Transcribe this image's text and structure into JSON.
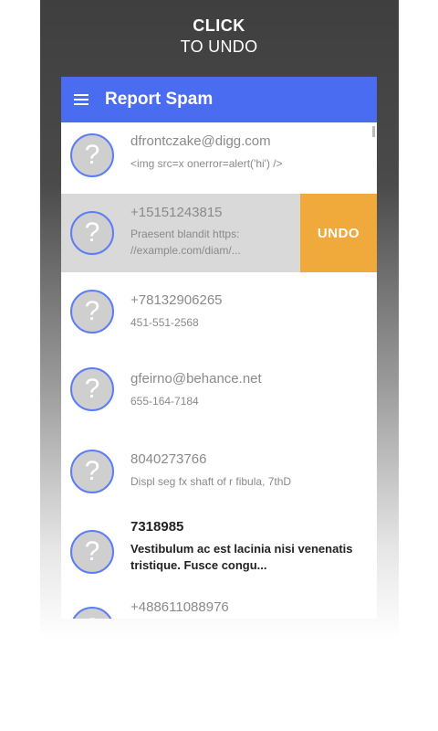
{
  "promo": {
    "headline_line1": "CLICK",
    "headline_line2": "TO UNDO"
  },
  "app_bar": {
    "title": "Report Spam",
    "menu_icon": "hamburger-menu-icon"
  },
  "list": [
    {
      "primary": "dfrontczake@digg.com",
      "secondary": "<img src=x onerror=alert('hi') />"
    },
    {
      "primary": "+15151243815",
      "secondary": "Praesent blandit https: //example.com/diam/...",
      "swiped": true,
      "action_label": "UNDO"
    },
    {
      "primary": "+78132906265",
      "secondary": "451-551-2568"
    },
    {
      "primary": "gfeirno@behance.net",
      "secondary": "655-164-7184"
    },
    {
      "primary": "8040273766",
      "secondary": "Displ seg fx shaft of r fibula, 7thD"
    },
    {
      "primary": "7318985",
      "secondary": "Vestibulum ac est lacinia nisi venenatis tristique. Fusce congu...",
      "unread": true
    },
    {
      "primary": "+488611088976",
      "secondary": ""
    }
  ],
  "avatar_glyph": "?",
  "colors": {
    "app_bar": "#4a6cf0",
    "undo_action": "#f0a93b",
    "avatar_border": "#5d7ef2",
    "swiped_row": "#d9d9d9"
  }
}
